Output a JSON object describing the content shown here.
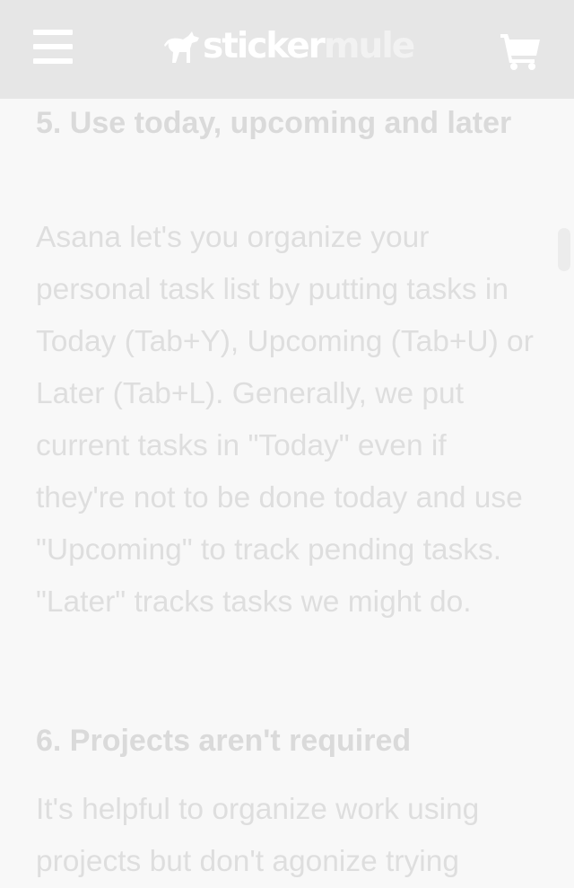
{
  "header": {
    "logo_text_a": "sticker",
    "logo_text_b": "mule",
    "menu_icon": "hamburger-menu-icon",
    "cart_icon": "shopping-cart-icon",
    "bg_color": "#e6e6e6"
  },
  "article": {
    "section5_title": "5. Use today, upcoming and later",
    "section5_body": "Asana let's you organize your personal task list by putting tasks in Today (Tab+Y), Upcoming (Tab+U) or Later (Tab+L). Generally, we put current tasks in \"Today\" even if they're not to be done today and use \"Upcoming\" to track pending tasks. \"Later\" tracks tasks we might do.",
    "section6_title": "6. Projects aren't required",
    "section6_body": "It's helpful to organize work using projects but don't agonize trying"
  }
}
